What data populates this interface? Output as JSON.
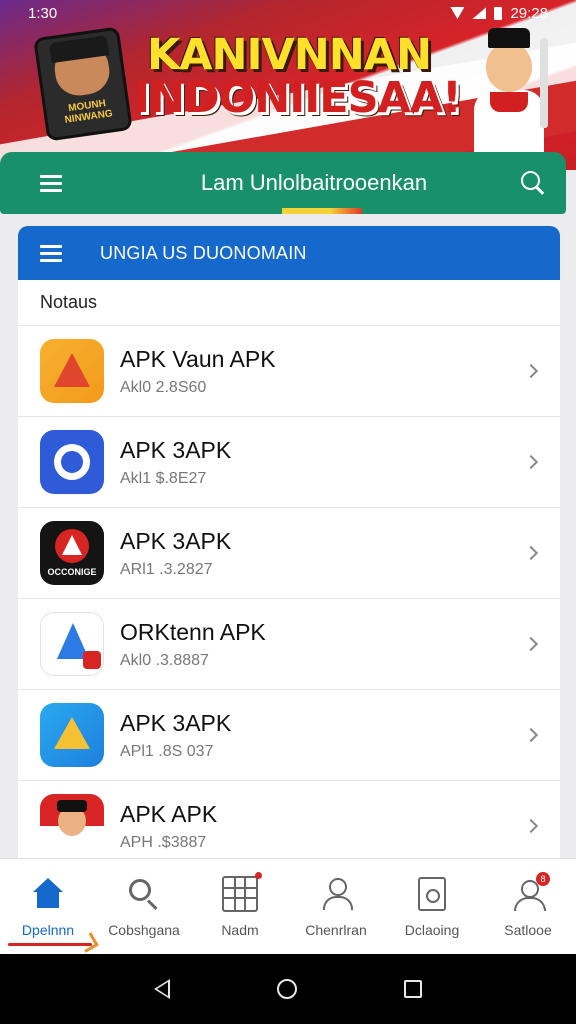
{
  "status_bar": {
    "time": "1:30",
    "clock_right": "29:28"
  },
  "banner": {
    "title_line1": "KANIVNNAN",
    "title_line2": "INDONIIESAA!",
    "phone_caption": "MOUNH NINWANG"
  },
  "appbar": {
    "title": "Lam Unlolbaitrooenkan"
  },
  "subbar": {
    "title": "UNGIA US DUONOMAIN"
  },
  "list": {
    "section_title": "Notaus",
    "items": [
      {
        "title": "APK Vaun APK",
        "subtitle": "Akl0 2.8S60",
        "icon": "orange-triangle-app-icon"
      },
      {
        "title": "APK 3APK",
        "subtitle": "Akl1 $.8E27",
        "icon": "blue-circle-app-icon"
      },
      {
        "title": "APK 3APK",
        "subtitle": "ARl1 .3.2827",
        "icon": "black-red-app-icon",
        "icon_caption": "OCCONIGE"
      },
      {
        "title": "ORKtenn APK",
        "subtitle": "Akl0 .3.8887",
        "icon": "white-blue-triangle-app-icon"
      },
      {
        "title": "APK 3APK",
        "subtitle": "APl1 .8S 037",
        "icon": "drive-app-icon"
      },
      {
        "title": "APK APK",
        "subtitle": "APH .$3887",
        "icon": "portrait-app-icon"
      }
    ]
  },
  "bottom_nav": {
    "items": [
      {
        "label": "Dpelnnn",
        "icon": "home-icon",
        "active": true
      },
      {
        "label": "Cobshgana",
        "icon": "search-icon",
        "active": false
      },
      {
        "label": "Nadm",
        "icon": "grid-icon",
        "active": false
      },
      {
        "label": "Chenrlran",
        "icon": "user-icon",
        "active": false
      },
      {
        "label": "Dclaoing",
        "icon": "document-icon",
        "active": false
      },
      {
        "label": "Satlooe",
        "icon": "account-icon",
        "active": false,
        "badge": "8"
      }
    ]
  },
  "colors": {
    "appbar_green": "#18906a",
    "subbar_blue": "#1568cc",
    "accent_red": "#d92424",
    "banner_yellow": "#ffe12b"
  }
}
